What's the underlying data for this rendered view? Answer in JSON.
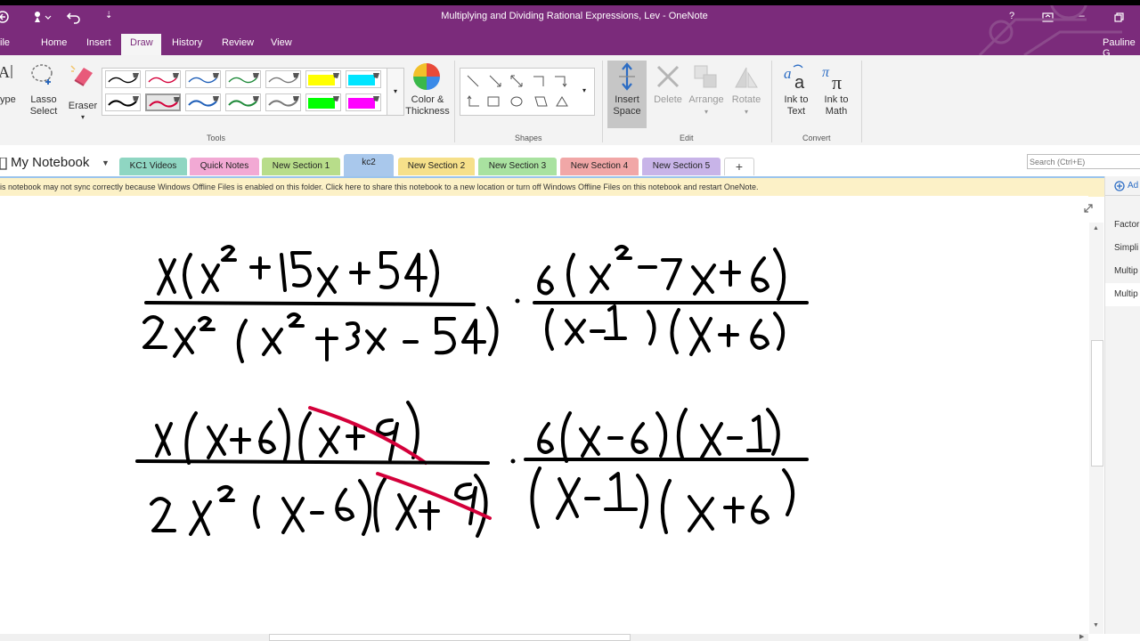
{
  "window": {
    "title": "Multiplying and Dividing Rational Expressions, Lev - OneNote",
    "help": "?",
    "minimize": "–",
    "user": "Pauline G"
  },
  "ribbon_tabs": [
    "ile",
    "Home",
    "Insert",
    "Draw",
    "History",
    "Review",
    "View"
  ],
  "ribbon": {
    "type_label": "ype",
    "lasso_label_1": "Lasso",
    "lasso_label_2": "Select",
    "eraser_label": "Eraser",
    "color_label_1": "Color &",
    "color_label_2": "Thickness",
    "tools_group": "Tools",
    "shapes_group": "Shapes",
    "insert_space_1": "Insert",
    "insert_space_2": "Space",
    "delete_label": "Delete",
    "arrange_label": "Arrange",
    "rotate_label": "Rotate",
    "edit_group": "Edit",
    "ink_text_1": "Ink to",
    "ink_text_2": "Text",
    "ink_math_1": "Ink to",
    "ink_math_2": "Math",
    "convert_group": "Convert"
  },
  "pens": [
    {
      "color": "#000000"
    },
    {
      "color": "#d4003a"
    },
    {
      "color": "#1f5fb8"
    },
    {
      "color": "#1f8a3a"
    },
    {
      "color": "#777777"
    },
    {
      "color": "#ffff00"
    },
    {
      "color": "#00e5ff"
    },
    {
      "color": "#000000"
    },
    {
      "color": "#d4003a"
    },
    {
      "color": "#1f5fb8"
    },
    {
      "color": "#1f8a3a"
    },
    {
      "color": "#777777"
    },
    {
      "color": "#00ff00"
    },
    {
      "color": "#ff00ff"
    }
  ],
  "notebook": {
    "name": "My Notebook",
    "sections": [
      {
        "label": "KC1 Videos",
        "color": "#8fd6c2"
      },
      {
        "label": "Quick Notes",
        "color": "#f2a9d4"
      },
      {
        "label": "New Section 1",
        "color": "#b8dd8a"
      },
      {
        "label": "kc2",
        "color": "#a9c8ec"
      },
      {
        "label": "New Section 2",
        "color": "#f6e08a"
      },
      {
        "label": "New Section 3",
        "color": "#a9e2a0"
      },
      {
        "label": "New Section 4",
        "color": "#f1a7a7"
      },
      {
        "label": "New Section 5",
        "color": "#c8b4e8"
      }
    ],
    "add_tab": "+"
  },
  "search": {
    "placeholder": "Search (Ctrl+E)"
  },
  "warning": "is notebook may not sync correctly because Windows Offline Files is enabled on this folder. Click here to share this notebook to a new location or turn off Windows Offline Files on this notebook and restart OneNote.",
  "pages_pane": {
    "add_label": "Ad",
    "pages": [
      "Factor",
      "Simpli",
      "Multip",
      "Multip"
    ]
  }
}
